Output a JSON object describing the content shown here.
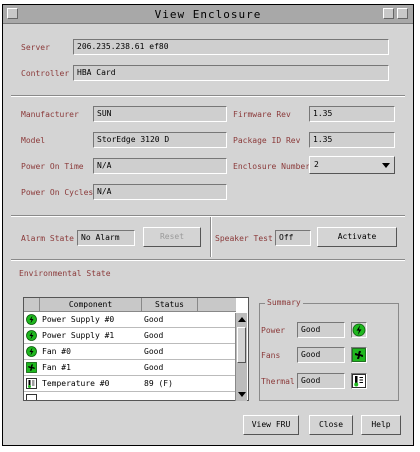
{
  "window": {
    "title": "View Enclosure"
  },
  "server": {
    "label": "Server",
    "value": "206.235.238.61 ef80"
  },
  "controller": {
    "label": "Controller",
    "value": "HBA Card"
  },
  "manufacturer": {
    "label": "Manufacturer",
    "value": "SUN"
  },
  "firmware": {
    "label": "Firmware Rev",
    "value": "1.35"
  },
  "model": {
    "label": "Model",
    "value": "StorEdge 3120 D"
  },
  "package_id": {
    "label": "Package ID Rev",
    "value": "1.35"
  },
  "power_on_time": {
    "label": "Power On Time",
    "value": "N/A"
  },
  "enclosure_number": {
    "label": "Enclosure Number",
    "value": "2"
  },
  "power_on_cycles": {
    "label": "Power On Cycles",
    "value": "N/A"
  },
  "alarm": {
    "label": "Alarm State",
    "value": "No Alarm",
    "reset_label": "Reset"
  },
  "speaker": {
    "label": "Speaker Test",
    "value": "Off",
    "activate_label": "Activate"
  },
  "env_title": "Environmental State",
  "table": {
    "headers": [
      "Component",
      "Status"
    ],
    "rows": [
      {
        "component": "Power Supply #0",
        "status": "Good",
        "icon": "power-icon"
      },
      {
        "component": "Power Supply #1",
        "status": "Good",
        "icon": "power-icon"
      },
      {
        "component": "Fan #0",
        "status": "Good",
        "icon": "power-icon"
      },
      {
        "component": "Fan #1",
        "status": "Good",
        "icon": "fan-icon"
      },
      {
        "component": "Temperature #0",
        "status": "89 (F)",
        "icon": "thermal-icon"
      }
    ]
  },
  "summary": {
    "title": "Summary",
    "items": [
      {
        "label": "Power",
        "value": "Good",
        "icon": "power-icon"
      },
      {
        "label": "Fans",
        "value": "Good",
        "icon": "fan-icon"
      },
      {
        "label": "Thermal",
        "value": "Good",
        "icon": "thermal-icon"
      }
    ]
  },
  "buttons": {
    "view_fru": "View FRU",
    "close": "Close",
    "help": "Help"
  },
  "colors": {
    "label": "#8b3a3a",
    "ok_green": "#1fb81f",
    "window_bg": "#d4d4d4"
  }
}
